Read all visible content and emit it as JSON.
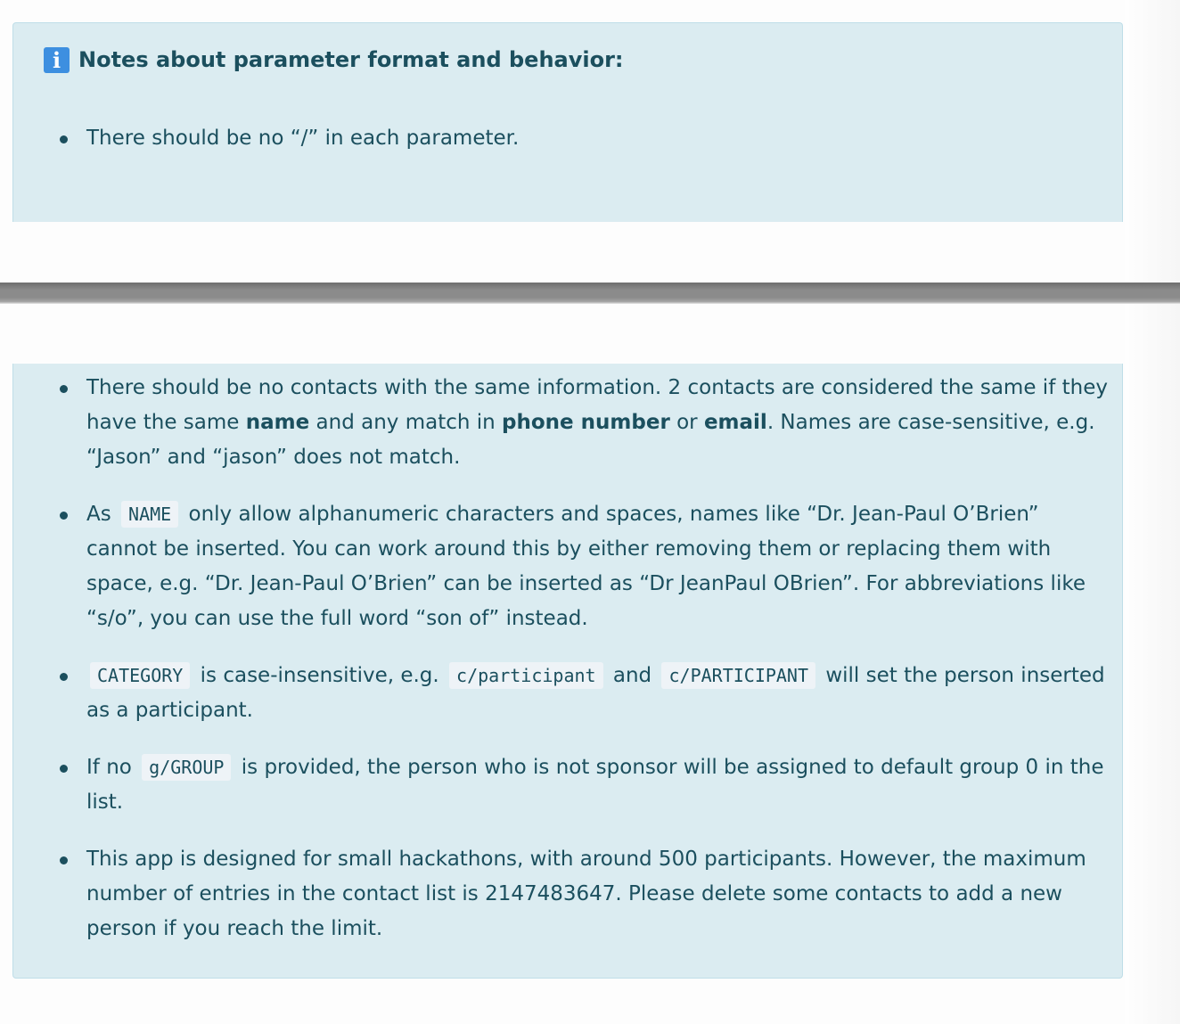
{
  "header": {
    "icon": "info-icon",
    "icon_glyph": "i",
    "title": "Notes about parameter format and behavior:"
  },
  "notes_top": [
    {
      "text": "There should be no “/” in each parameter."
    }
  ],
  "notes": {
    "same_contact": {
      "part1": "There should be no contacts with the same information. 2 contacts are considered the same if they have the same ",
      "bold1": "name",
      "part2": " and any match in ",
      "bold2": "phone number",
      "part3": " or ",
      "bold3": "email",
      "part4": ". Names are case-sensitive, e.g. “Jason” and “jason” does not match."
    },
    "name_chars": {
      "part1": "As",
      "code1": "NAME",
      "part2": "only allow alphanumeric characters and spaces, names like “Dr. Jean-Paul O’Brien” cannot be inserted. You can work around this by either removing them or replacing them with space, e.g. “Dr. Jean-Paul O’Brien” can be inserted as “Dr JeanPaul OBrien”. For abbreviations like “s/o”, you can use the full word “son of” instead."
    },
    "category": {
      "code1": "CATEGORY",
      "part1": "is case-insensitive, e.g.",
      "code2": "c/participant",
      "part2": "and",
      "code3": "c/PARTICIPANT",
      "part3": "will set the person inserted as a participant."
    },
    "group": {
      "part1": "If no",
      "code1": "g/GROUP",
      "part2": "is provided, the person who is not sponsor will be assigned to default group 0 in the list."
    },
    "limit": {
      "text": "This app is designed for small hackathons, with around 500 participants. However, the maximum number of entries in the contact list is 2147483647. Please delete some contacts to add a new person if you reach the limit."
    }
  },
  "colors": {
    "box_bg": "#dbecf1",
    "box_border": "#bfdee8",
    "text": "#1b4f5e",
    "icon_bg": "#3d8fe0",
    "divider": "#8b8b8b",
    "code_bg": "#eef3f7"
  }
}
